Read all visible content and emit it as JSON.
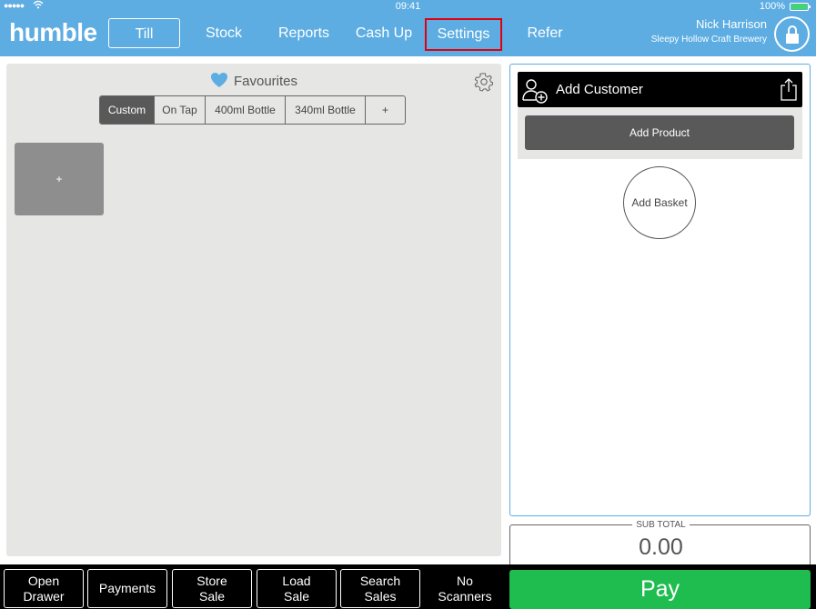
{
  "status_bar": {
    "signal": "●●●●●",
    "time": "09:41",
    "battery": "100%"
  },
  "header": {
    "logo": "humble",
    "nav": [
      {
        "label": "Till"
      },
      {
        "label": "Stock"
      },
      {
        "label": "Reports"
      },
      {
        "label": "Cash Up"
      },
      {
        "label": "Settings"
      },
      {
        "label": "Refer"
      }
    ],
    "user_name": "Nick Harrison",
    "company": "Sleepy Hollow Craft Brewery"
  },
  "favourites": {
    "title": "Favourites",
    "tabs": [
      {
        "label": "Custom"
      },
      {
        "label": "On Tap"
      },
      {
        "label": "400ml Bottle"
      },
      {
        "label": "340ml Bottle"
      },
      {
        "label": "+"
      }
    ],
    "add_tile_label": "+"
  },
  "basket": {
    "add_customer": "Add Customer",
    "add_product": "Add Product",
    "add_basket": "Add Basket"
  },
  "subtotal": {
    "label": "SUB TOTAL",
    "value": "0.00"
  },
  "bottom_bar": {
    "buttons": [
      {
        "label": "Open\nDrawer"
      },
      {
        "label": "Payments"
      },
      {
        "label": "Store\nSale"
      },
      {
        "label": "Load\nSale"
      },
      {
        "label": "Search\nSales"
      },
      {
        "label": "No\nScanners"
      }
    ],
    "pay": "Pay"
  },
  "colors": {
    "header": "#5dade2",
    "pay": "#1fbd4f",
    "highlight": "#e0000f",
    "heart": "#5dade2"
  },
  "icons": [
    "wifi-icon",
    "battery-icon",
    "lock-icon",
    "heart-icon",
    "gear-icon",
    "add-person-icon",
    "share-icon"
  ]
}
